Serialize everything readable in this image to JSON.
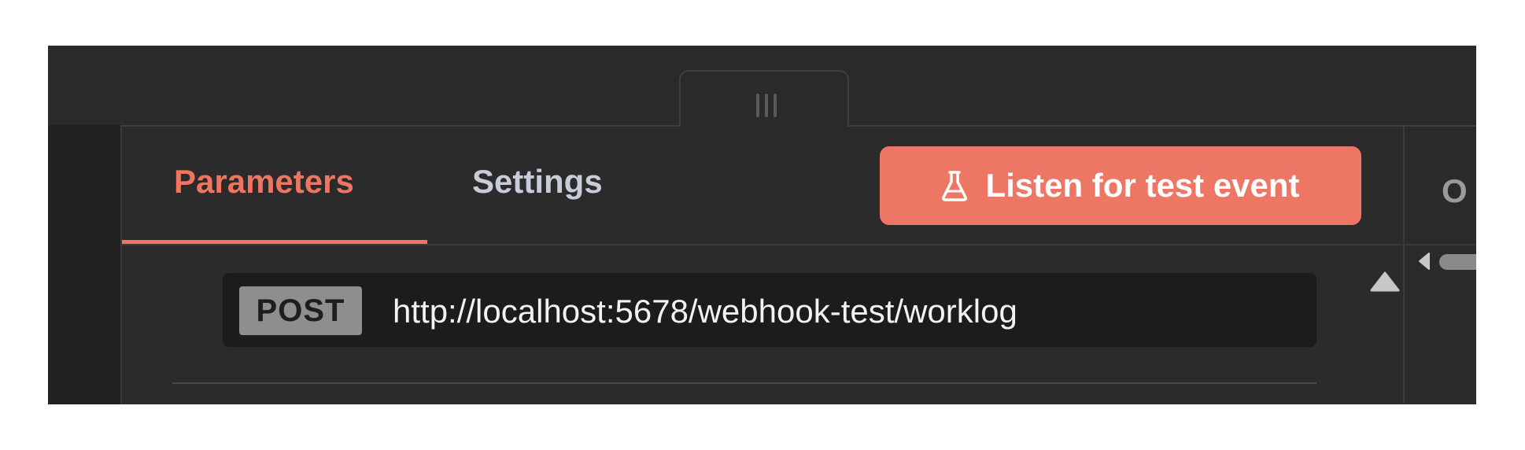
{
  "tabs": {
    "parameters": "Parameters",
    "settings": "Settings",
    "active": "parameters"
  },
  "listen_button": {
    "label": "Listen for test event",
    "icon": "flask-icon"
  },
  "webhook": {
    "method": "POST",
    "url": "http://localhost:5678/webhook-test/worklog"
  },
  "right_panel": {
    "partial_text": "O"
  },
  "icons": {
    "drag_handle": "grip-icon",
    "scroll_up": "triangle-up-icon",
    "scroll_left": "triangle-left-icon"
  },
  "colors": {
    "accent": "#ee7664",
    "background": "#2a2a2a",
    "url_box": "#1c1c1c",
    "method_badge": "#8e8e8e"
  }
}
